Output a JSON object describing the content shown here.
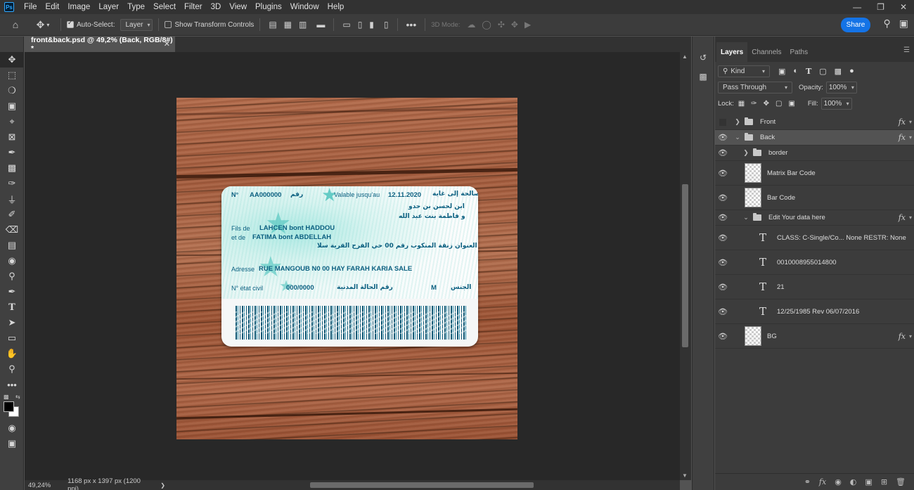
{
  "menu": {
    "logo": "Ps",
    "items": [
      "File",
      "Edit",
      "Image",
      "Layer",
      "Type",
      "Select",
      "Filter",
      "3D",
      "View",
      "Plugins",
      "Window",
      "Help"
    ]
  },
  "options": {
    "auto_select_label": "Auto-Select:",
    "auto_select_checked": true,
    "auto_select_target": "Layer",
    "transform_label": "Show Transform Controls",
    "transform_checked": false,
    "three_d_mode": "3D Mode:",
    "share_label": "Share"
  },
  "document": {
    "tab_title": "front&back.psd @ 49,2% (Back, RGB/8#) *",
    "zoom": "49,24%",
    "info": "1168 px x 1397 px (1200 ppi)"
  },
  "card": {
    "no_label": "N°",
    "no_value": "AA000000",
    "no_ar": "رقم",
    "valid_label": "Valable jusqu'au",
    "valid_date": "12.11.2020",
    "valid_ar": "صالحة إلى غاية",
    "parents_ar_1": "ابن لحسن بن حدو",
    "parents_ar_2": "و فاطمة بنت عبد الله",
    "fils_label": "Fils de",
    "fils_value": "LAHCEN bont HADDOU",
    "etde_label": "et de",
    "etde_value": "FATIMA bont ABDELLAH",
    "address_ar": "العنوان زنقة المنكوب رقم 00 حي الفرح القرية سلا",
    "address_label": "Adresse",
    "address_value": "RUE MANGOUB N0 00 HAY FARAH KARIA SALE",
    "civil_label": "N° état civil",
    "civil_value": "000/0000",
    "civil_ar": "رقم الحالة المدنية",
    "sex_value": "M",
    "sex_ar": "الجنس"
  },
  "layers_panel": {
    "tabs": [
      "Layers",
      "Channels",
      "Paths"
    ],
    "filter_kind": "Kind",
    "blend_mode": "Pass Through",
    "opacity_label": "Opacity:",
    "opacity_value": "100%",
    "lock_label": "Lock:",
    "fill_label": "Fill:",
    "fill_value": "100%",
    "layers": [
      {
        "name": "Front",
        "kind": "group",
        "visible": false,
        "fx": true
      },
      {
        "name": "Back",
        "kind": "group",
        "visible": true,
        "fx": true,
        "selected": true
      },
      {
        "name": "border",
        "kind": "group",
        "visible": true
      },
      {
        "name": "Matrix Bar Code",
        "kind": "pixel",
        "visible": true
      },
      {
        "name": "Bar Code",
        "kind": "pixel",
        "visible": true
      },
      {
        "name": "Edit Your data here",
        "kind": "group",
        "visible": true,
        "fx": true
      },
      {
        "name": "CLASS: C-Single/Co... None RESTR: None",
        "kind": "text",
        "visible": true
      },
      {
        "name": "0010008955014800",
        "kind": "text",
        "visible": true
      },
      {
        "name": "21",
        "kind": "text",
        "visible": true
      },
      {
        "name": "12/25/1985 Rev 06/07/2016",
        "kind": "text",
        "visible": true
      },
      {
        "name": "BG",
        "kind": "pixel",
        "visible": true,
        "fx": true
      }
    ]
  }
}
